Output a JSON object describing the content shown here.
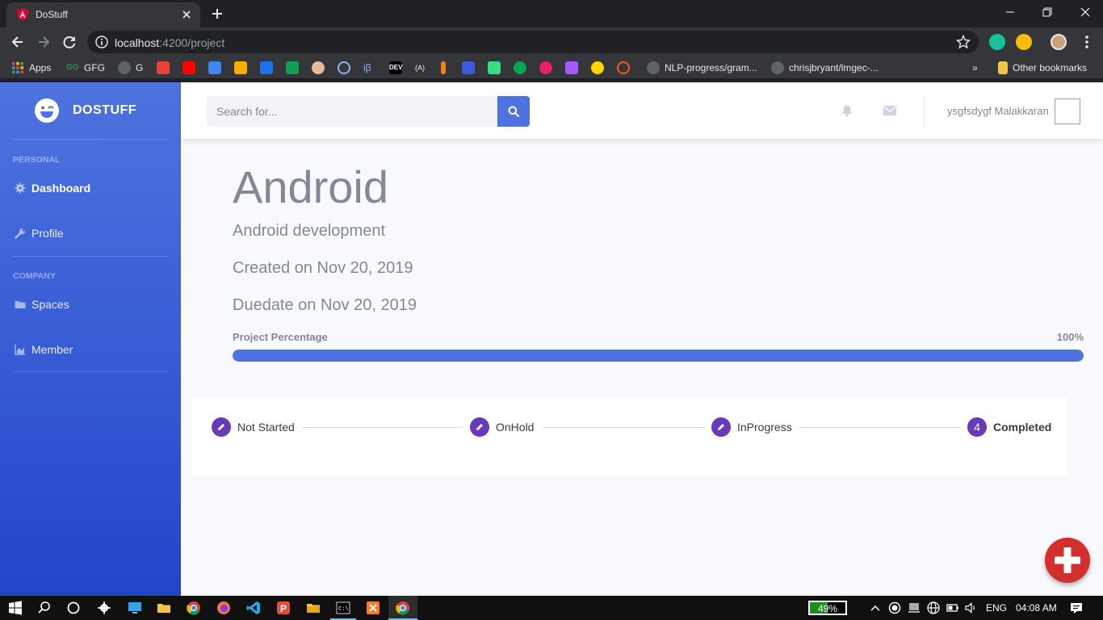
{
  "browser": {
    "tab_title": "DoStuff",
    "url_host": "localhost",
    "url_rest": ":4200/project",
    "bookmarks": [
      {
        "label": "Apps",
        "color": "#e53935"
      },
      {
        "label": "GFG",
        "color": "#2f8d46"
      },
      {
        "label": "G",
        "color": "#24292e"
      },
      {
        "label": "NLP-progress/gram...",
        "color": "#24292e"
      },
      {
        "label": "chrisjbryant/lmgec-...",
        "color": "#24292e"
      },
      {
        "label": "Other bookmarks",
        "color": "#f4c542"
      }
    ]
  },
  "brand": {
    "name": "DOSTUFF"
  },
  "sidebar": {
    "personal_heading": "PERSONAL",
    "company_heading": "COMPANY",
    "items": [
      {
        "label": "Dashboard",
        "icon": "gear-icon"
      },
      {
        "label": "Profile",
        "icon": "wrench-icon"
      },
      {
        "label": "Spaces",
        "icon": "folder-icon"
      },
      {
        "label": "Member",
        "icon": "chart-area-icon"
      }
    ]
  },
  "topbar": {
    "search_placeholder": "Search for...",
    "username": "ysgfsdygf Malakkaran"
  },
  "project": {
    "title": "Android",
    "description": "Android development",
    "created": "Created on Nov 20, 2019",
    "duedate": "Duedate on Nov 20, 2019",
    "progress_label": "Project Percentage",
    "progress_value": "100%",
    "progress_fraction": 1.0
  },
  "stepper": {
    "steps": [
      {
        "label": "Not Started",
        "marker": "edit-icon"
      },
      {
        "label": "OnHold",
        "marker": "edit-icon"
      },
      {
        "label": "InProgress",
        "marker": "edit-icon"
      },
      {
        "label": "Completed",
        "marker": "4"
      }
    ]
  },
  "taskbar": {
    "battery": "49%",
    "battery_fraction": 0.49,
    "language": "ENG",
    "time": "04:08 AM"
  },
  "colors": {
    "primary": "#4e73df",
    "step": "#673ab7",
    "fab": "#d32f2f"
  }
}
